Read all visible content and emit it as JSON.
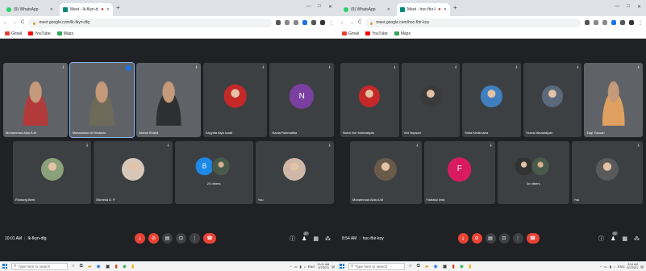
{
  "colors": {
    "meet_bg": "#202124",
    "tile_bg": "#3c4043",
    "end_call": "#ea4335",
    "active_speaker": "#1a73e8"
  },
  "left": {
    "tabs": [
      {
        "label": "(9) WhatsApp",
        "icon": "whatsapp-icon",
        "active": false
      },
      {
        "label": "Meet - lk-fkyn-dfg",
        "icon": "meet-icon",
        "active": true
      }
    ],
    "url": "meet.google.com/lk-fkyn-dfg",
    "bookmarks": [
      {
        "label": "Gmail",
        "icon": "gmail-icon"
      },
      {
        "label": "YouTube",
        "icon": "youtube-icon"
      },
      {
        "label": "Maps",
        "icon": "maps-icon"
      }
    ],
    "top_tiles": [
      {
        "name": "Muhammad Aldo A.M",
        "kind": "video",
        "color": "#b33a3a"
      },
      {
        "name": "Muhammad Al Murtado",
        "kind": "video",
        "color": "#6d6a5a",
        "speaking": true
      },
      {
        "name": "Ahmat Khalid",
        "kind": "video",
        "color": "#2e2f30"
      },
      {
        "name": "Sayyida Alya Izzati",
        "kind": "avatar",
        "color": "#c62828"
      },
      {
        "name": "Nadia Rahmatika",
        "kind": "letter",
        "letter": "N",
        "color": "#7b3fa0"
      }
    ],
    "bottom_tiles": [
      {
        "name": "Rindang Berti",
        "kind": "avatar",
        "color": "#8aa17a"
      },
      {
        "name": "Michella D. P.",
        "kind": "avatar",
        "color": "#d7c7b8"
      },
      {
        "kind": "others",
        "others_label": "23 others",
        "letter": "B",
        "color": "#1e88e5"
      },
      {
        "name": "You",
        "kind": "avatar",
        "color": "#d0b8a8"
      }
    ],
    "meeting_time": "10:01 AM",
    "meeting_code": "lk-fkyn-dfg",
    "participant_count": "27",
    "taskbar_search": "Type here to search",
    "clock_time": "10:01 AM",
    "clock_date": "6/7/2021"
  },
  "right": {
    "tabs": [
      {
        "label": "(9) WhatsApp",
        "icon": "whatsapp-icon",
        "active": false
      },
      {
        "label": "Meet - hoc-fhir-koy",
        "icon": "meet-icon",
        "active": true
      }
    ],
    "url": "meet.google.com/hoc-fhir-koy",
    "bookmarks": [
      {
        "label": "Gmail",
        "icon": "gmail-icon"
      },
      {
        "label": "YouTube",
        "icon": "youtube-icon"
      },
      {
        "label": "Maps",
        "icon": "maps-icon"
      }
    ],
    "top_tiles": [
      {
        "name": "Nutra Nur Muhdaliyah",
        "kind": "avatar",
        "color": "#c62828"
      },
      {
        "name": "Vivi Nopsari",
        "kind": "avatar",
        "color": "#3a3a3a"
      },
      {
        "name": "Sinta Kholimaha",
        "kind": "avatar",
        "color": "#3f7fbf"
      },
      {
        "name": "Triana Maulaidiyah",
        "kind": "avatar",
        "color": "#5a6a7a"
      },
      {
        "name": "Zaqi Yusuari",
        "kind": "video",
        "color": "#e0a060"
      }
    ],
    "bottom_tiles": [
      {
        "name": "Muhammad Aldo A.M",
        "kind": "avatar",
        "color": "#6a5a4a"
      },
      {
        "name": "Fadlatul ilma",
        "kind": "letter",
        "letter": "F",
        "color": "#d81b60"
      },
      {
        "kind": "others",
        "others_label": "3o others",
        "color": "#444"
      },
      {
        "name": "You",
        "kind": "avatar",
        "color": "#5a5a5a"
      }
    ],
    "meeting_time": "8:54 AM",
    "meeting_code": "hoc-fhir-koy",
    "participant_count": "37",
    "taskbar_search": "Type here to search",
    "clock_time": "8:54 AM",
    "clock_date": "6/7/2021"
  }
}
